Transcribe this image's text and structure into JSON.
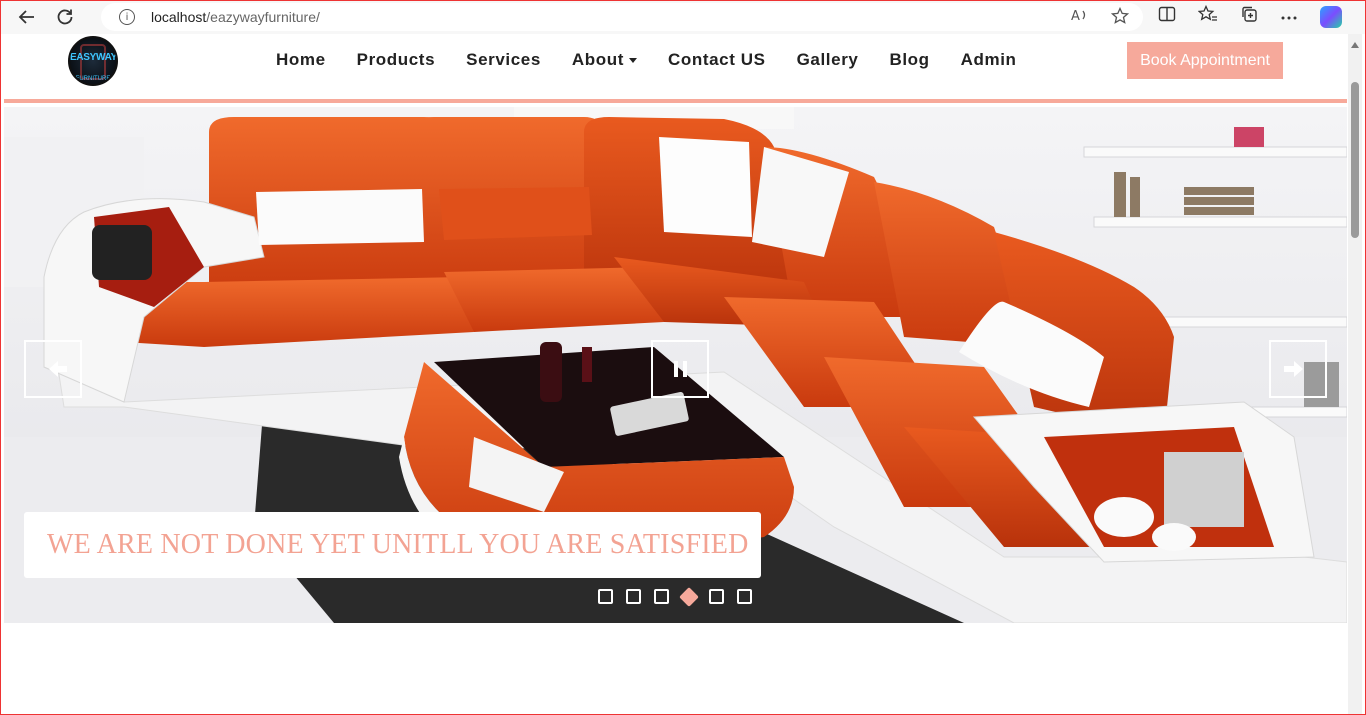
{
  "browser": {
    "url_host": "localhost",
    "url_path": "/eazywayfurniture/"
  },
  "header": {
    "logo_text": "EASYWAY",
    "logo_sub": "FURNITURE",
    "nav": [
      {
        "label": "Home"
      },
      {
        "label": "Products"
      },
      {
        "label": "Services"
      },
      {
        "label": "About"
      },
      {
        "label": "Contact US"
      },
      {
        "label": "Gallery"
      },
      {
        "label": "Blog"
      },
      {
        "label": "Admin"
      }
    ],
    "cta_label": "Book Appointment"
  },
  "slider": {
    "caption": "WE ARE NOT DONE YET UNITLL YOU ARE SATISFIED",
    "slide_count": 6,
    "active_index": 3
  },
  "colors": {
    "accent": "#f6a99b",
    "sofa": "#e24a17"
  }
}
